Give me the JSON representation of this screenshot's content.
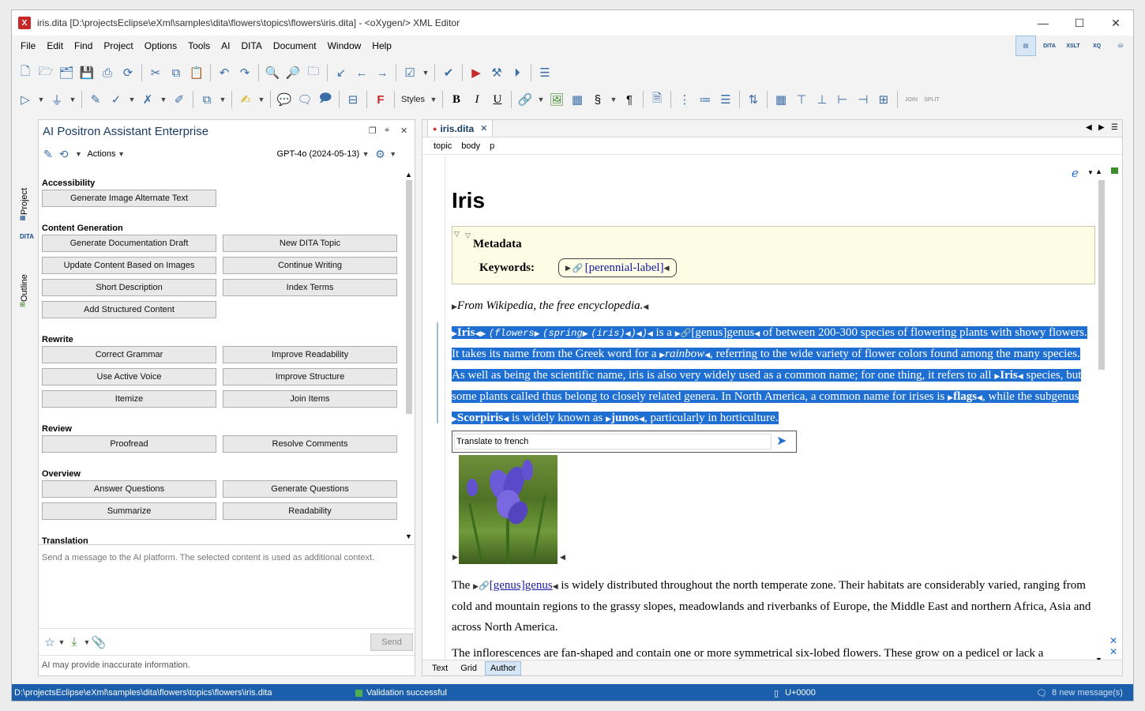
{
  "window": {
    "title": "iris.dita [D:\\projectsEclipse\\eXml\\samples\\dita\\flowers\\topics\\flowers\\iris.dita] - <oXygen/> XML Editor"
  },
  "menu": [
    "File",
    "Edit",
    "Find",
    "Project",
    "Options",
    "Tools",
    "AI",
    "DITA",
    "Document",
    "Window",
    "Help"
  ],
  "perspectives": [
    "DITA",
    "XSLT",
    "XQ"
  ],
  "toolbar": {
    "styles_label": "Styles"
  },
  "side_tabs": {
    "project": "Project",
    "outline": "Outline",
    "dita": "DITA"
  },
  "ai": {
    "title": "AI Positron Assistant Enterprise",
    "actions_label": "Actions",
    "model": "GPT-4o (2024-05-13)",
    "sections": [
      {
        "name": "Accessibility",
        "buttons": [
          "Generate Image Alternate Text"
        ]
      },
      {
        "name": "Content Generation",
        "buttons": [
          "Generate Documentation Draft",
          "New DITA Topic",
          "Update Content Based on Images",
          "Continue Writing",
          "Short Description",
          "Index Terms",
          "Add Structured Content"
        ]
      },
      {
        "name": "Rewrite",
        "buttons": [
          "Correct Grammar",
          "Improve Readability",
          "Use Active Voice",
          "Improve Structure",
          "Itemize",
          "Join Items"
        ]
      },
      {
        "name": "Review",
        "buttons": [
          "Proofread",
          "Resolve Comments"
        ]
      },
      {
        "name": "Overview",
        "buttons": [
          "Answer Questions",
          "Generate Questions",
          "Summarize",
          "Readability"
        ]
      },
      {
        "name": "Translation",
        "buttons": []
      }
    ],
    "input_placeholder": "Send a message to the AI platform. The selected content is used as additional context.",
    "send_label": "Send",
    "disclaimer": "AI may provide inaccurate information."
  },
  "editor": {
    "tab": "iris.dita",
    "breadcrumb": [
      "topic",
      "body",
      "p"
    ],
    "heading": "Iris",
    "metadata_title": "Metadata",
    "keywords_label": "Keywords:",
    "keyword": "[perennial-label]",
    "para0": "From Wikipedia, the free encyclopedia.",
    "sel": {
      "iris": "Iris",
      "flowers": "(flowers",
      "spring": "(spring",
      "iris_paren": "(iris)",
      "close": ")",
      "t_is_a": " is a ",
      "genus_ref": "[genus]genus",
      "t1": " of between 200-300 species of flowering plants with showy flowers. It takes its name from the Greek word for a ",
      "rainbow": "rainbow",
      "t2": ", referring to the wide variety of flower colors found among the many species. As well as being the scientific name, iris is also very widely used as a common name; for one thing, it refers to all ",
      "iris2": "Iris",
      "t3": " species, but some plants called thus belong to closely related genera. In North America, a common name for irises is ",
      "flags": "flags",
      "t4": ", while the subgenus ",
      "scorpiris": "Scorpiris",
      "t5": " is widely known as ",
      "junos": "junos",
      "t6": ", particularly in horticulture."
    },
    "translate_value": "Translate to french",
    "para2": {
      "pre": "The ",
      "link": "[genus]genus",
      "post": " is widely distributed throughout the north temperate zone. Their habitats are considerably varied, ranging from cold and mountain regions to the grassy slopes, meadowlands and riverbanks of Europe, the Middle East and northern Africa, Asia and across North America."
    },
    "para3": "The inflorescences are fan-shaped and contain one or more symmetrical six-lobed flowers. These grow on a pedicel or lack a",
    "modes": [
      "Text",
      "Grid",
      "Author"
    ]
  },
  "status": {
    "path": "D:\\projectsEclipse\\eXml\\samples\\dita\\flowers\\topics\\flowers\\iris.dita",
    "validation": "Validation successful",
    "unicode": "U+0000",
    "messages": "8 new message(s)"
  }
}
